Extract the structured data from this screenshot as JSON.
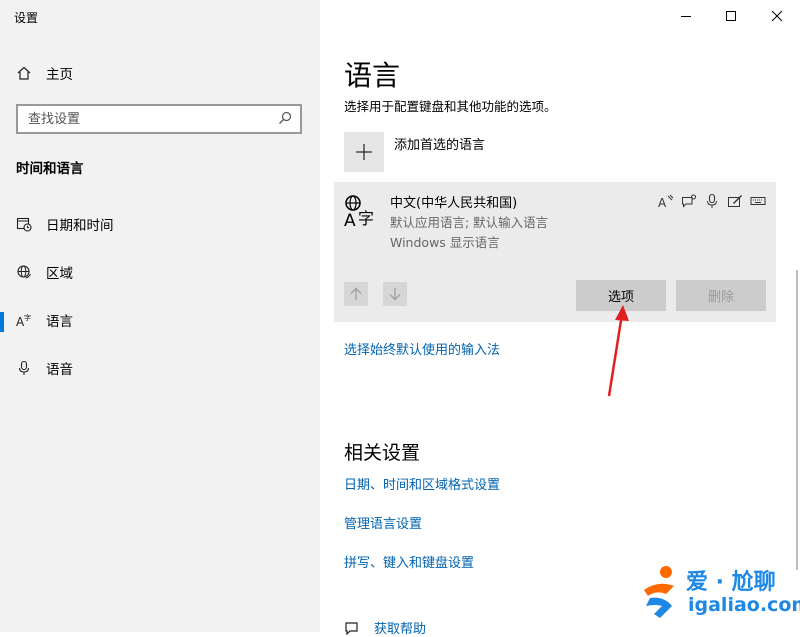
{
  "window": {
    "title": "设置"
  },
  "sidebar": {
    "home": "主页",
    "search_placeholder": "查找设置",
    "section": "时间和语言",
    "items": [
      {
        "label": "日期和时间",
        "icon": "calendar-clock-icon"
      },
      {
        "label": "区域",
        "icon": "globe-region-icon"
      },
      {
        "label": "语言",
        "icon": "language-icon",
        "active": true
      },
      {
        "label": "语音",
        "icon": "microphone-icon"
      }
    ]
  },
  "main": {
    "title": "语言",
    "subtitle": "选择用于配置键盘和其他功能的选项。",
    "add_language": "添加首选的语言",
    "language": {
      "name": "中文(中华人民共和国)",
      "line1": "默认应用语言; 默认输入语言",
      "line2": "Windows 显示语言",
      "options_button": "选项",
      "remove_button": "删除"
    },
    "input_method_link": "选择始终默认使用的输入法",
    "related_title": "相关设置",
    "related_links": [
      "日期、时间和区域格式设置",
      "管理语言设置",
      "拼写、键入和键盘设置"
    ],
    "help": "获取帮助"
  },
  "watermark": {
    "text": "爱 · 尬聊",
    "url": "igaliao.com"
  },
  "colors": {
    "accent": "#0078d7",
    "link": "#0063b1",
    "annotation": "#e02020"
  }
}
